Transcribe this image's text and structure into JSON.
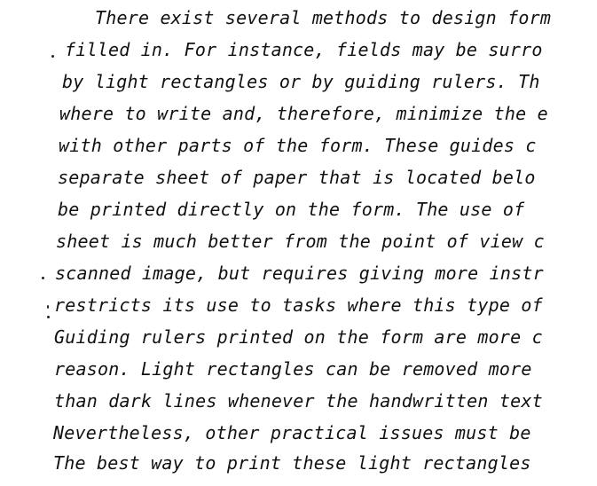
{
  "document": {
    "lines": [
      "There exist several methods to design form",
      "filled in.  For instance, fields may be surro",
      "by light rectangles or by guiding rulers.  Th",
      "where to write and, therefore, minimize the e",
      "with other parts of the form.  These guides c",
      "separate sheet of paper that is located belo",
      "be printed directly on the form.  The use of",
      "sheet is much better from the point of view c",
      "scanned image, but requires giving more instr",
      "restricts its use to tasks where this type of",
      "Guiding rulers printed on the form are more c",
      "reason.  Light rectangles can be removed more",
      "than dark lines whenever the handwritten text",
      "Nevertheless, other practical issues must be",
      "The best way to print these light rectangles"
    ]
  }
}
